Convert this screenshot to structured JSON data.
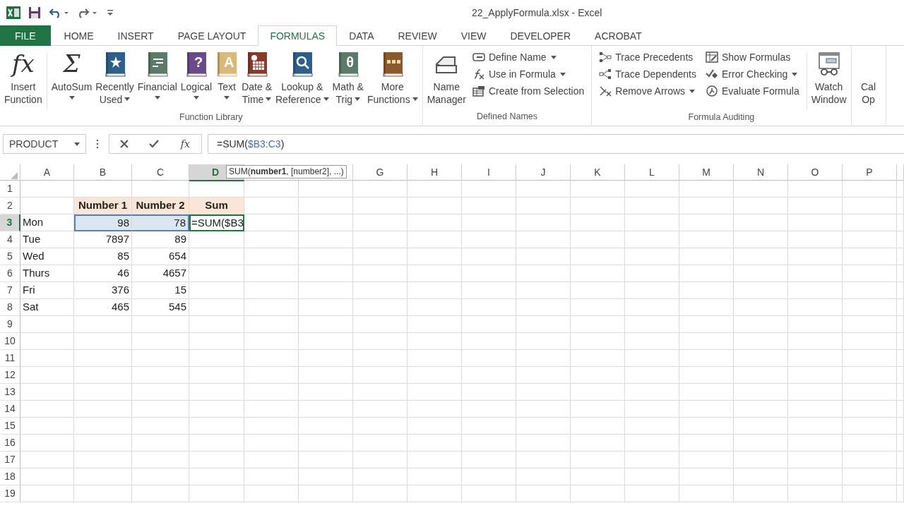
{
  "window": {
    "title": "22_ApplyFormula.xlsx - Excel"
  },
  "tabs": [
    {
      "label": "FILE",
      "kind": "file",
      "selected": false
    },
    {
      "label": "HOME",
      "kind": "tab",
      "selected": false
    },
    {
      "label": "INSERT",
      "kind": "tab",
      "selected": false
    },
    {
      "label": "PAGE LAYOUT",
      "kind": "tab",
      "selected": false
    },
    {
      "label": "FORMULAS",
      "kind": "tab",
      "selected": true
    },
    {
      "label": "DATA",
      "kind": "tab",
      "selected": false
    },
    {
      "label": "REVIEW",
      "kind": "tab",
      "selected": false
    },
    {
      "label": "VIEW",
      "kind": "tab",
      "selected": false
    },
    {
      "label": "DEVELOPER",
      "kind": "tab",
      "selected": false
    },
    {
      "label": "ACROBAT",
      "kind": "tab",
      "selected": false
    }
  ],
  "ribbon": {
    "groups": [
      {
        "label": "Function Library",
        "items": [
          {
            "kind": "glyph",
            "label": "Insert\nFunction",
            "glyph": "fx",
            "dropdown": false
          },
          {
            "kind": "divider"
          },
          {
            "kind": "glyph",
            "label": "AutoSum",
            "glyph": "Σ",
            "dropdown": true
          },
          {
            "kind": "book",
            "label": "Recently\nUsed",
            "color": "#2e5f8a",
            "dropdown": true
          },
          {
            "kind": "book",
            "label": "Financial",
            "color": "#5b7a6a",
            "dropdown": true
          },
          {
            "kind": "book",
            "label": "Logical",
            "color": "#6b4a8a",
            "glyph": "?",
            "dropdown": true
          },
          {
            "kind": "book",
            "label": "Text",
            "color": "#d9b878",
            "glyph": "A",
            "dropdown": true
          },
          {
            "kind": "book",
            "label": "Date &\nTime",
            "color": "#8a3a2a",
            "dropdown": true
          },
          {
            "kind": "book",
            "label": "Lookup &\nReference",
            "color": "#2e5f8a",
            "dropdown": true
          },
          {
            "kind": "book",
            "label": "Math &\nTrig",
            "color": "#5b7a6a",
            "glyph": "θ",
            "dropdown": true
          },
          {
            "kind": "book",
            "label": "More\nFunctions",
            "color": "#8a5a2a",
            "dropdown": true
          }
        ]
      },
      {
        "label": "Defined Names",
        "items": [
          {
            "kind": "name-manager",
            "label": "Name\nManager",
            "dropdown": false
          },
          {
            "kind": "column",
            "items": [
              {
                "label": "Define Name",
                "dropdown": true
              },
              {
                "label": "Use in Formula",
                "dropdown": true
              },
              {
                "label": "Create from Selection",
                "dropdown": false
              }
            ]
          }
        ]
      },
      {
        "label": "Formula Auditing",
        "items": [
          {
            "kind": "column",
            "items": [
              {
                "label": "Trace Precedents",
                "dropdown": false
              },
              {
                "label": "Trace Dependents",
                "dropdown": false
              },
              {
                "label": "Remove Arrows",
                "dropdown": true
              }
            ]
          },
          {
            "kind": "column",
            "items": [
              {
                "label": "Show Formulas",
                "dropdown": false
              },
              {
                "label": "Error Checking",
                "dropdown": true
              },
              {
                "label": "Evaluate Formula",
                "dropdown": false
              }
            ]
          },
          {
            "kind": "divider"
          },
          {
            "kind": "watch",
            "label": "Watch\nWindow",
            "dropdown": false
          }
        ]
      },
      {
        "items": [
          {
            "kind": "plain",
            "label": "Cal\nOp",
            "dropdown": false
          }
        ]
      }
    ]
  },
  "formula_bar": {
    "name_box": "PRODUCT",
    "function_button": "fx",
    "formula": [
      {
        "text": "=SUM(",
        "kind": "plain"
      },
      {
        "text": "$B3:C3",
        "kind": "ref"
      },
      {
        "text": ")",
        "kind": "plain"
      }
    ]
  },
  "column_headers": [
    {
      "label": "A",
      "selected": false
    },
    {
      "label": "B",
      "selected": false
    },
    {
      "label": "C",
      "selected": false
    },
    {
      "label": "D",
      "selected": true,
      "tooltip": "SUM(**number1**, [number2], ...)"
    },
    {
      "label": "G",
      "selected": false
    },
    {
      "label": "H",
      "selected": false
    },
    {
      "label": "I",
      "selected": false
    },
    {
      "label": "J",
      "selected": false
    },
    {
      "label": "K",
      "selected": false
    },
    {
      "label": "L",
      "selected": false
    },
    {
      "label": "M",
      "selected": false
    },
    {
      "label": "N",
      "selected": false
    },
    {
      "label": "O",
      "selected": false
    },
    {
      "label": "P",
      "selected": false
    }
  ],
  "rows": [
    {
      "label": "1",
      "selected": false,
      "kind": "blank"
    },
    {
      "label": "2",
      "selected": false,
      "kind": "header",
      "number_1": "Number 1",
      "number_2": "Number 2",
      "sum": "Sum"
    },
    {
      "label": "3",
      "selected": true,
      "kind": "data",
      "day": "Mon",
      "number_1": "98",
      "number_2": "78",
      "sum": "=SUM($B3"
    },
    {
      "label": "4",
      "selected": false,
      "kind": "data",
      "day": "Tue",
      "number_1": "7897",
      "number_2": "89"
    },
    {
      "label": "5",
      "selected": false,
      "kind": "data",
      "day": "Wed",
      "number_1": "85",
      "number_2": "654"
    },
    {
      "label": "6",
      "selected": false,
      "kind": "data",
      "day": "Thurs",
      "number_1": "46",
      "number_2": "4657"
    },
    {
      "label": "7",
      "selected": false,
      "kind": "data",
      "day": "Fri",
      "number_1": "376",
      "number_2": "15"
    },
    {
      "label": "8",
      "selected": false,
      "kind": "data",
      "day": "Sat",
      "number_1": "465",
      "number_2": "545"
    },
    {
      "label": "9",
      "selected": false,
      "kind": "blank"
    },
    {
      "label": "10",
      "selected": false,
      "kind": "blank"
    },
    {
      "label": "11",
      "selected": false,
      "kind": "blank"
    },
    {
      "label": "12",
      "selected": false,
      "kind": "blank"
    },
    {
      "label": "13",
      "selected": false,
      "kind": "blank"
    },
    {
      "label": "14",
      "selected": false,
      "kind": "blank"
    },
    {
      "label": "15",
      "selected": false,
      "kind": "blank"
    },
    {
      "label": "16",
      "selected": false,
      "kind": "blank"
    },
    {
      "label": "17",
      "selected": false,
      "kind": "blank"
    },
    {
      "label": "18",
      "selected": false,
      "kind": "blank"
    },
    {
      "label": "19",
      "selected": false,
      "kind": "blank"
    }
  ]
}
